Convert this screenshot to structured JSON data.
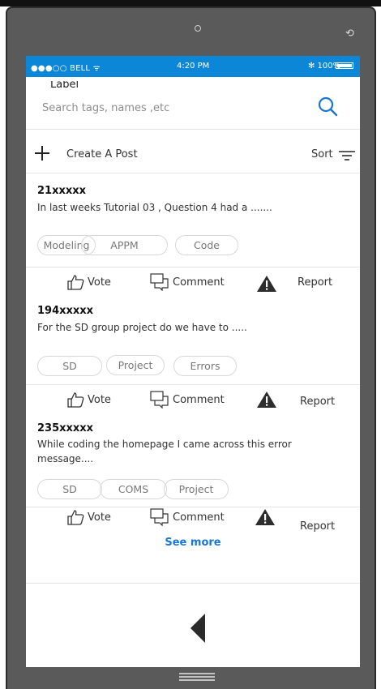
{
  "status_bar": {
    "carrier": "●●●○○ BELL ᯤ",
    "time": "4:20 PM",
    "battery": "✻ 100%"
  },
  "search": {
    "label": "Label",
    "placeholder": "Search tags, names ,etc",
    "icon": "search-icon"
  },
  "toolbar": {
    "create_label": "Create A Post",
    "sort_label": "Sort",
    "create_icon": "plus-icon",
    "sort_icon": "filter-lines-icon"
  },
  "actions": {
    "vote": "Vote",
    "comment": "Comment",
    "report": "Report"
  },
  "posts": [
    {
      "author": "21xxxxx",
      "body": "In last weeks Tutorial 03 , Question 4 had a .......",
      "tags": [
        "Modeling",
        "APPM",
        "Code"
      ]
    },
    {
      "author": "194xxxxx",
      "body": "For the SD group project do we have to .....",
      "tags": [
        "SD",
        "Project",
        "Errors"
      ]
    },
    {
      "author": "235xxxxx",
      "body": "While coding the homepage I came across this error message....",
      "tags": [
        "SD",
        "COMS",
        "Project"
      ]
    }
  ],
  "see_more": "See more",
  "colors": {
    "accent": "#0c86d6",
    "link": "#1976d2",
    "frame": "#5a5a5a"
  }
}
